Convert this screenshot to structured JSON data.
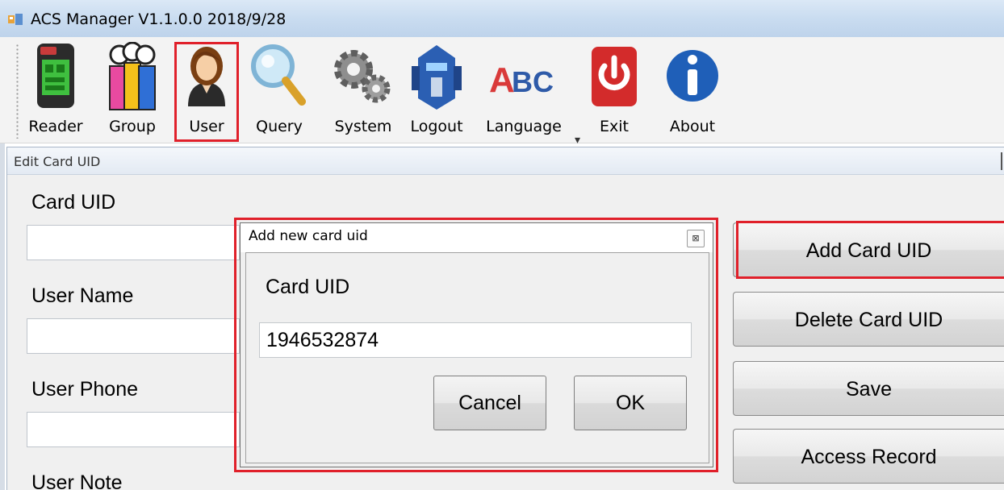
{
  "window": {
    "title": "ACS Manager V1.1.0.0  2018/9/28"
  },
  "toolbar": {
    "items": [
      {
        "label": "Reader",
        "icon": "reader-terminal-icon"
      },
      {
        "label": "Group",
        "icon": "group-people-icon"
      },
      {
        "label": "User",
        "icon": "user-avatar-icon"
      },
      {
        "label": "Query",
        "icon": "magnifier-icon"
      },
      {
        "label": "System",
        "icon": "gears-icon"
      },
      {
        "label": "Logout",
        "icon": "robot-head-icon"
      },
      {
        "label": "Language",
        "icon": "abc-text-icon"
      },
      {
        "label": "Exit",
        "icon": "power-icon"
      },
      {
        "label": "About",
        "icon": "info-icon"
      }
    ],
    "highlight_color": "#e0202a"
  },
  "panel": {
    "title": "Edit Card UID",
    "fields": [
      {
        "label": "Card UID",
        "value": ""
      },
      {
        "label": "User Name",
        "value": ""
      },
      {
        "label": "User Phone",
        "value": ""
      },
      {
        "label": "User Note",
        "value": ""
      }
    ],
    "buttons": [
      {
        "label": "Add Card UID"
      },
      {
        "label": "Delete Card UID"
      },
      {
        "label": "Save"
      },
      {
        "label": "Access Record"
      }
    ]
  },
  "dialog": {
    "title": "Add new card uid",
    "close_glyph": "⊠",
    "field_label": "Card UID",
    "field_value": "1946532874",
    "cancel_label": "Cancel",
    "ok_label": "OK"
  }
}
